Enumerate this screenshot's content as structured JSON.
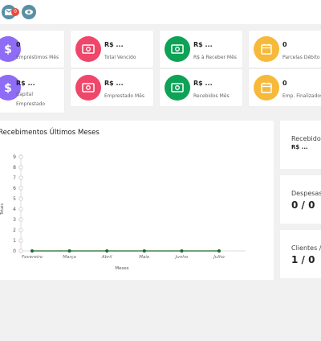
{
  "topbar": {
    "icons": [
      {
        "name": "mail-icon",
        "badge": "0"
      },
      {
        "name": "eye-icon"
      }
    ]
  },
  "cards": [
    {
      "value": "0",
      "label": "Empréstimos Mês",
      "color": "#8e6cf5",
      "icon": "dollar-icon"
    },
    {
      "value": "R$ ...",
      "label": "Total Vencido",
      "color": "#f0466a",
      "icon": "money-icon"
    },
    {
      "value": "R$ ...",
      "label": "R$ à Receber Mês",
      "color": "#0ea257",
      "icon": "money-icon"
    },
    {
      "value": "0",
      "label": "Parcelas Débito",
      "color": "#f7b93a",
      "icon": "calendar-icon"
    },
    {
      "value": "R$ ...",
      "label": "Capital Emprestado",
      "color": "#8e6cf5",
      "icon": "dollar-icon"
    },
    {
      "value": "R$ ...",
      "label": "Emprestado Mês",
      "color": "#f0466a",
      "icon": "money-icon"
    },
    {
      "value": "R$ ...",
      "label": "Recebidos Mês",
      "color": "#0ea257",
      "icon": "money-icon"
    },
    {
      "value": "0",
      "label": "Emp. Finalizados",
      "color": "#f7b93a",
      "icon": "calendar-icon"
    }
  ],
  "chart": {
    "title": "Recebimentos Últimos Meses"
  },
  "chart_data": {
    "type": "line",
    "title": "Recebimentos Últimos Meses",
    "xlabel": "Meses",
    "ylabel": "Totais",
    "categories": [
      "Fevereiro",
      "Março",
      "Abril",
      "Maio",
      "Junho",
      "Julho"
    ],
    "series": [
      {
        "values": [
          0,
          0,
          0,
          0,
          0,
          0
        ],
        "color": "#1e6b2e"
      }
    ],
    "yticks": [
      0,
      1,
      2,
      3,
      4,
      5,
      6,
      7,
      8,
      9
    ],
    "ylim": [
      0,
      9
    ],
    "grid": false
  },
  "stats": [
    {
      "label": "Recebidos",
      "value": "R$ ..."
    },
    {
      "label": "Despesas",
      "value": "0 / 0"
    },
    {
      "label": "Clientes /",
      "value": "1 / 0"
    }
  ]
}
